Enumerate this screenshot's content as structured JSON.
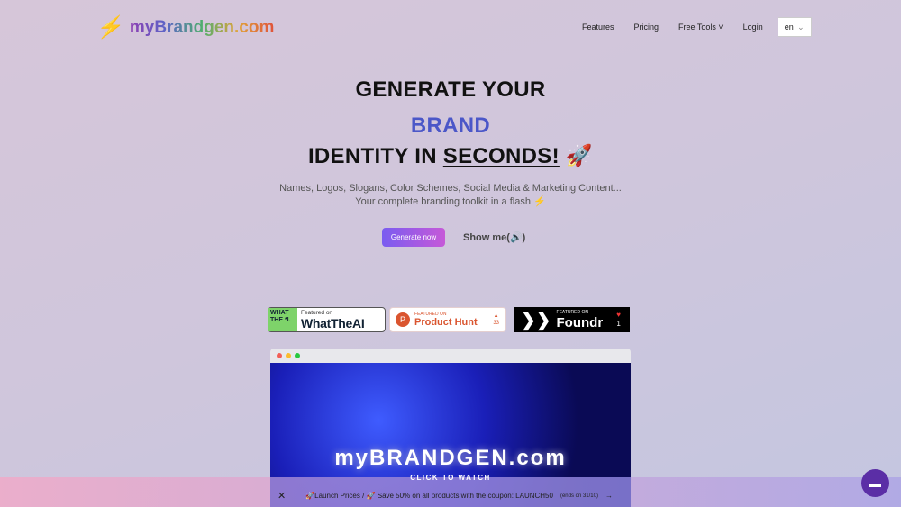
{
  "header": {
    "logo": "myBrandgen.com",
    "nav": [
      "Features",
      "Pricing",
      "Free Tools",
      "Login"
    ],
    "lang": "en"
  },
  "hero": {
    "line1": "GENERATE YOUR",
    "line2": "BRAND",
    "line3a": "IDENTITY IN ",
    "line3b": "SECONDS!",
    "line3c": " 🚀",
    "sub1": "Names, Logos, Slogans, Color Schemes, Social Media & Marketing Content...",
    "sub2": "Your complete branding toolkit in a flash ⚡",
    "cta": "Generate now",
    "show": "Show me(🔊)"
  },
  "badges": {
    "wta": {
      "mark": "WHAT THE *I.",
      "small": "Featured on",
      "name": "WhatTheAI"
    },
    "ph": {
      "small": "FEATURED ON",
      "name": "Product Hunt",
      "count": "33"
    },
    "foundr": {
      "small": "FEATURED ON",
      "name": "Foundr",
      "count": "1"
    }
  },
  "video": {
    "title": "myBRANDGEN.com",
    "cta": "CLICK TO WATCH"
  },
  "banner": {
    "text": "🚀Launch Prices / 🚀 Save 50% on all products with the coupon: LAUNCH50",
    "ends": "(ends on 31/10)"
  }
}
